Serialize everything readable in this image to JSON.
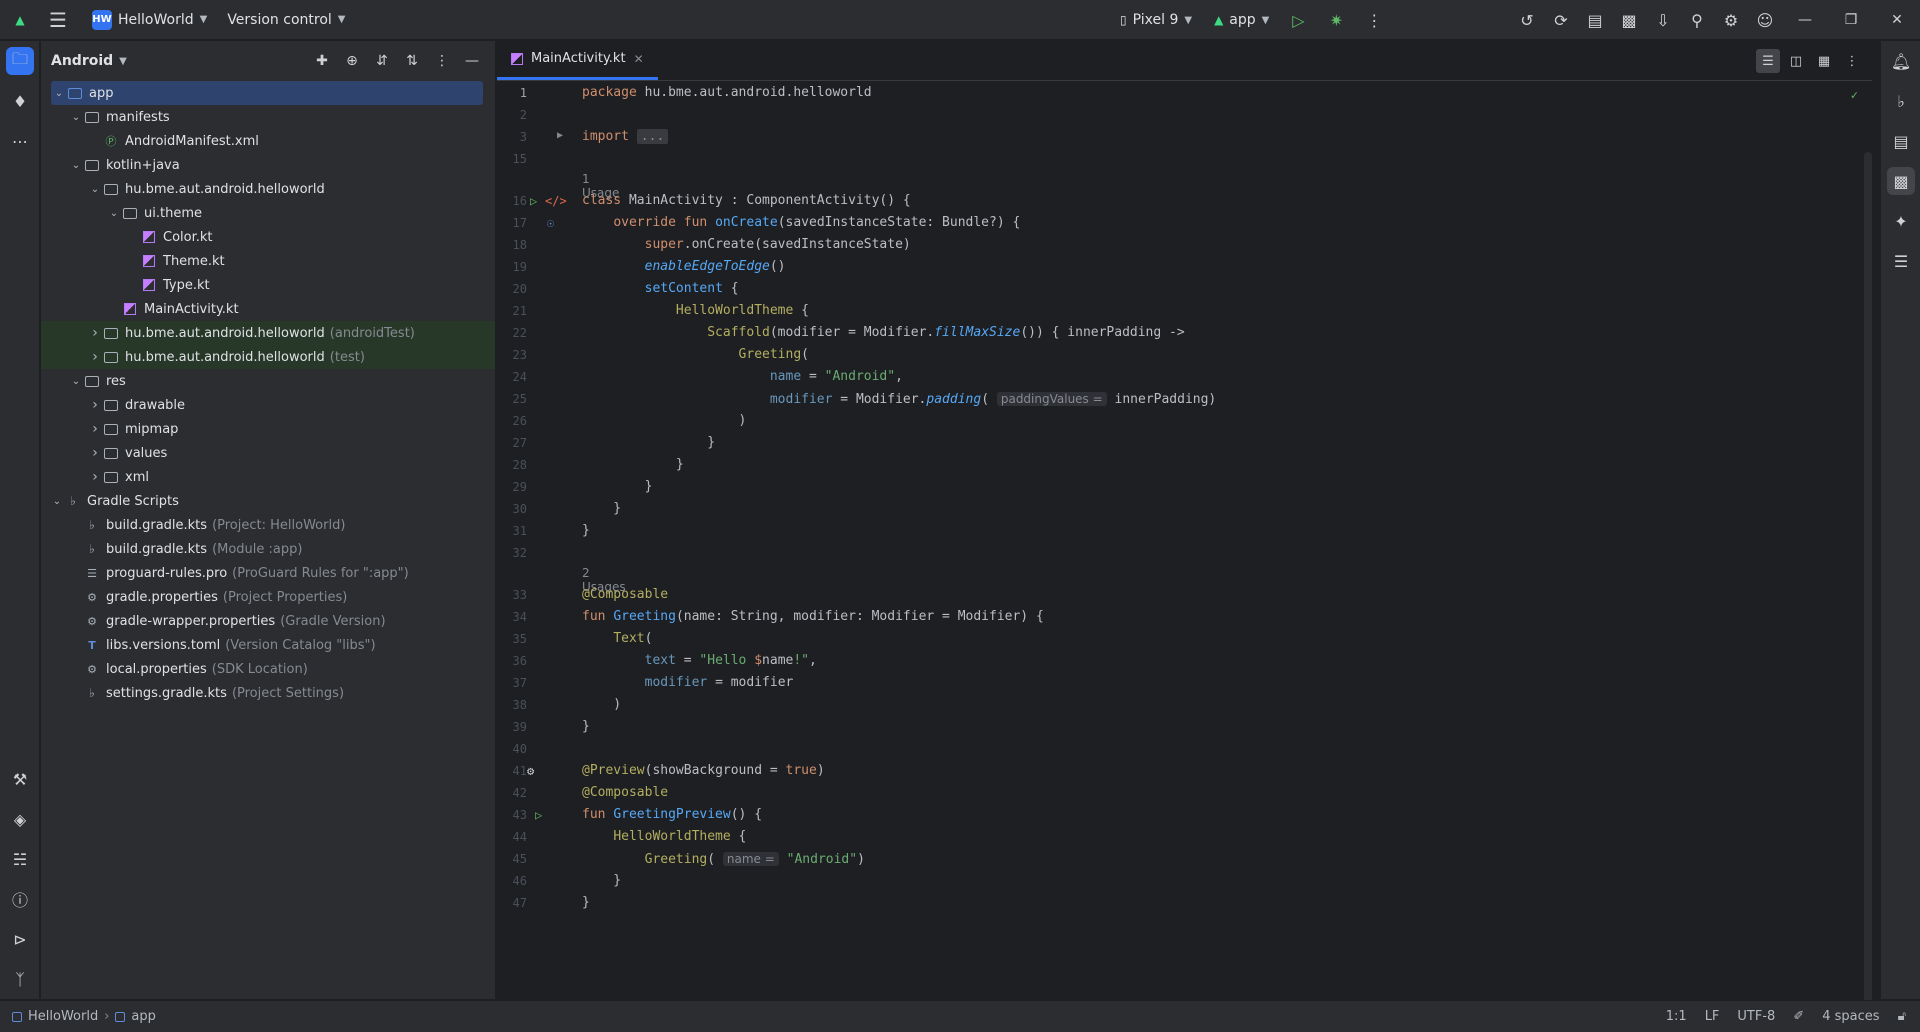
{
  "titlebar": {
    "project_badge": "HW",
    "project_name": "HelloWorld",
    "vcs_label": "Version control",
    "device": "Pixel 9",
    "run_config": "app"
  },
  "project_panel": {
    "view_label": "Android",
    "tree": [
      {
        "label": "app",
        "hint": "",
        "level": 0,
        "expanded": "open",
        "icon": "module-folder-icon",
        "selected": true
      },
      {
        "label": "manifests",
        "hint": "",
        "level": 1,
        "expanded": "open",
        "icon": "folder-icon"
      },
      {
        "label": "AndroidManifest.xml",
        "hint": "",
        "level": 2,
        "expanded": "",
        "icon": "manifest-file-icon"
      },
      {
        "label": "kotlin+java",
        "hint": "",
        "level": 1,
        "expanded": "open",
        "icon": "folder-icon"
      },
      {
        "label": "hu.bme.aut.android.helloworld",
        "hint": "",
        "level": 2,
        "expanded": "open",
        "icon": "package-icon"
      },
      {
        "label": "ui.theme",
        "hint": "",
        "level": 3,
        "expanded": "open",
        "icon": "package-icon"
      },
      {
        "label": "Color.kt",
        "hint": "",
        "level": 4,
        "expanded": "",
        "icon": "kotlin-file-icon"
      },
      {
        "label": "Theme.kt",
        "hint": "",
        "level": 4,
        "expanded": "",
        "icon": "kotlin-file-icon"
      },
      {
        "label": "Type.kt",
        "hint": "",
        "level": 4,
        "expanded": "",
        "icon": "kotlin-file-icon"
      },
      {
        "label": "MainActivity.kt",
        "hint": "",
        "level": 3,
        "expanded": "",
        "icon": "kotlin-file-icon"
      },
      {
        "label": "hu.bme.aut.android.helloworld",
        "hint": "(androidTest)",
        "level": 2,
        "expanded": "closed",
        "icon": "package-icon",
        "green": true
      },
      {
        "label": "hu.bme.aut.android.helloworld",
        "hint": "(test)",
        "level": 2,
        "expanded": "closed",
        "icon": "package-icon",
        "green": true
      },
      {
        "label": "res",
        "hint": "",
        "level": 1,
        "expanded": "open",
        "icon": "resource-folder-icon"
      },
      {
        "label": "drawable",
        "hint": "",
        "level": 2,
        "expanded": "closed",
        "icon": "folder-icon"
      },
      {
        "label": "mipmap",
        "hint": "",
        "level": 2,
        "expanded": "closed",
        "icon": "folder-icon"
      },
      {
        "label": "values",
        "hint": "",
        "level": 2,
        "expanded": "closed",
        "icon": "folder-icon"
      },
      {
        "label": "xml",
        "hint": "",
        "level": 2,
        "expanded": "closed",
        "icon": "folder-icon"
      },
      {
        "label": "Gradle Scripts",
        "hint": "",
        "level": 0,
        "expanded": "open",
        "icon": "gradle-icon"
      },
      {
        "label": "build.gradle.kts",
        "hint": "(Project: HelloWorld)",
        "level": 1,
        "expanded": "",
        "icon": "gradle-icon"
      },
      {
        "label": "build.gradle.kts",
        "hint": "(Module :app)",
        "level": 1,
        "expanded": "",
        "icon": "gradle-icon"
      },
      {
        "label": "proguard-rules.pro",
        "hint": "(ProGuard Rules for \":app\")",
        "level": 1,
        "expanded": "",
        "icon": "text-file-icon"
      },
      {
        "label": "gradle.properties",
        "hint": "(Project Properties)",
        "level": 1,
        "expanded": "",
        "icon": "settings-file-icon"
      },
      {
        "label": "gradle-wrapper.properties",
        "hint": "(Gradle Version)",
        "level": 1,
        "expanded": "",
        "icon": "settings-file-icon"
      },
      {
        "label": "libs.versions.toml",
        "hint": "(Version Catalog \"libs\")",
        "level": 1,
        "expanded": "",
        "icon": "toml-file-icon"
      },
      {
        "label": "local.properties",
        "hint": "(SDK Location)",
        "level": 1,
        "expanded": "",
        "icon": "settings-file-icon"
      },
      {
        "label": "settings.gradle.kts",
        "hint": "(Project Settings)",
        "level": 1,
        "expanded": "",
        "icon": "gradle-icon"
      }
    ]
  },
  "editor": {
    "tab_label": "MainActivity.kt",
    "usage_1": "1 Usage",
    "usage_2": "2 Usages",
    "inlay_padding": "paddingValues =",
    "inlay_name": "name ="
  },
  "statusbar": {
    "crumb_project": "HelloWorld",
    "crumb_module": "app",
    "position": "1:1",
    "line_sep": "LF",
    "encoding": "UTF-8",
    "indent": "4 spaces"
  }
}
